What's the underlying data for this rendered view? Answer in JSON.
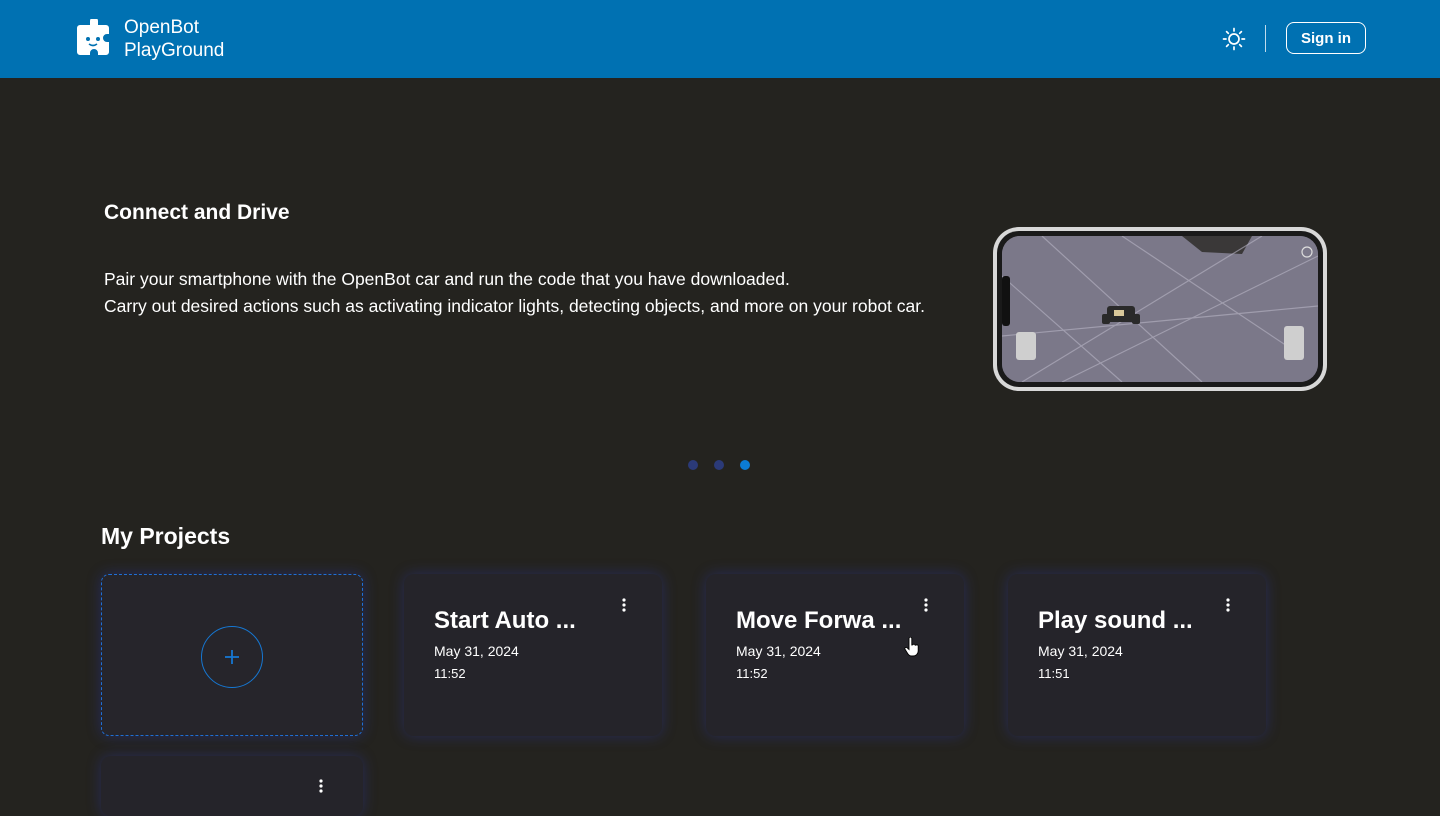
{
  "header": {
    "logo_line1": "OpenBot",
    "logo_line2": "PlayGround",
    "logo_icon": "puzzle-robot-icon",
    "theme_icon": "sun-icon",
    "signin_label": "Sign in",
    "bg_color": "#0071b2"
  },
  "carousel": {
    "title": "Connect and Drive",
    "description_line1": "Pair your smartphone with the OpenBot car and run the code that you have downloaded.",
    "description_line2": "Carry out desired actions such as activating indicator lights, detecting objects, and more on your robot car.",
    "slide_count": 3,
    "active_slide": 3
  },
  "projects": {
    "title": "My Projects",
    "new_project_icon": "plus-icon",
    "items": [
      {
        "name": "Start Auto ...",
        "date": "May 31, 2024",
        "time": "11:52"
      },
      {
        "name": "Move Forwa ...",
        "date": "May 31, 2024",
        "time": "11:52"
      },
      {
        "name": "Play sound ...",
        "date": "May 31, 2024",
        "time": "11:51"
      }
    ]
  },
  "colors": {
    "accent": "#0b7bd4",
    "background": "#24231f"
  }
}
